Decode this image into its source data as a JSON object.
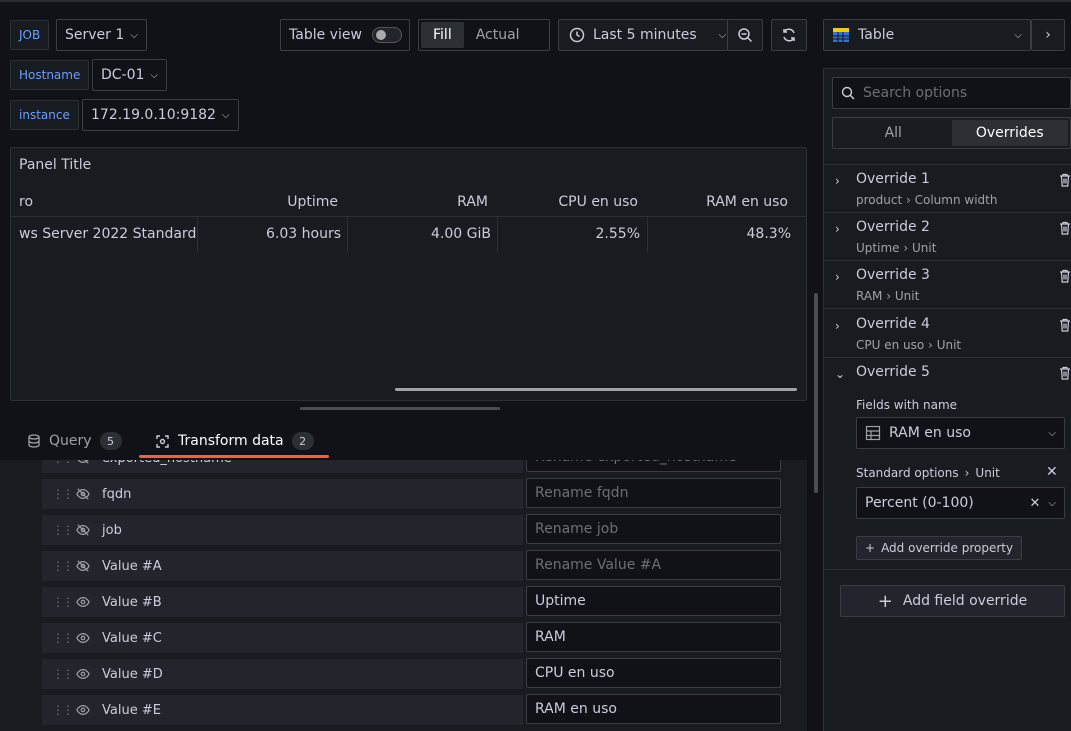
{
  "variables": {
    "job": {
      "label": "JOB",
      "value": "Server 1"
    },
    "hostname": {
      "label": "Hostname",
      "value": "DC-01"
    },
    "instance": {
      "label": "instance",
      "value": "172.19.0.10:9182"
    }
  },
  "toolbar": {
    "table_view_label": "Table view",
    "fill_label": "Fill",
    "actual_label": "Actual",
    "time_range": "Last 5 minutes",
    "visualization": "Table"
  },
  "panel": {
    "title": "Panel Title",
    "columns": [
      "ro",
      "Uptime",
      "RAM",
      "CPU en uso",
      "RAM en uso"
    ],
    "row": [
      "ws Server 2022 Standard",
      "6.03 hours",
      "4.00 GiB",
      "2.55%",
      "48.3%"
    ]
  },
  "tabs": {
    "query_label": "Query",
    "query_count": "5",
    "transform_label": "Transform data",
    "transform_count": "2"
  },
  "transform_rows": [
    {
      "name": "exported_hostname",
      "input": "Rename exported_hostname",
      "is_placeholder": true,
      "visible": false
    },
    {
      "name": "fqdn",
      "input": "Rename fqdn",
      "is_placeholder": true,
      "visible": false
    },
    {
      "name": "job",
      "input": "Rename job",
      "is_placeholder": true,
      "visible": false
    },
    {
      "name": "Value #A",
      "input": "Rename Value #A",
      "is_placeholder": true,
      "visible": false
    },
    {
      "name": "Value #B",
      "input": "Uptime",
      "is_placeholder": false,
      "visible": true
    },
    {
      "name": "Value #C",
      "input": "RAM",
      "is_placeholder": false,
      "visible": true
    },
    {
      "name": "Value #D",
      "input": "CPU en uso",
      "is_placeholder": false,
      "visible": true
    },
    {
      "name": "Value #E",
      "input": "RAM en uso",
      "is_placeholder": false,
      "visible": true
    }
  ],
  "sidebar": {
    "search_placeholder": "Search options",
    "segment_all": "All",
    "segment_overrides": "Overrides",
    "overrides": [
      {
        "title": "Override 1",
        "field": "product",
        "prop": "Column width"
      },
      {
        "title": "Override 2",
        "field": "Uptime",
        "prop": "Unit"
      },
      {
        "title": "Override 3",
        "field": "RAM",
        "prop": "Unit"
      },
      {
        "title": "Override 4",
        "field": "CPU en uso",
        "prop": "Unit"
      },
      {
        "title": "Override 5",
        "field": "",
        "prop": ""
      }
    ],
    "fields_with_name_label": "Fields with name",
    "fields_with_name_value": "RAM en uso",
    "standard_options_label": "Standard options",
    "unit_label": "Unit",
    "unit_value": "Percent (0-100)",
    "add_override_property": "Add override property",
    "add_field_override": "Add field override"
  },
  "colors": {
    "accent_orange": "#f55f3e",
    "link_blue": "#6e9fff",
    "background": "#111217",
    "panel": "#181b1f"
  }
}
